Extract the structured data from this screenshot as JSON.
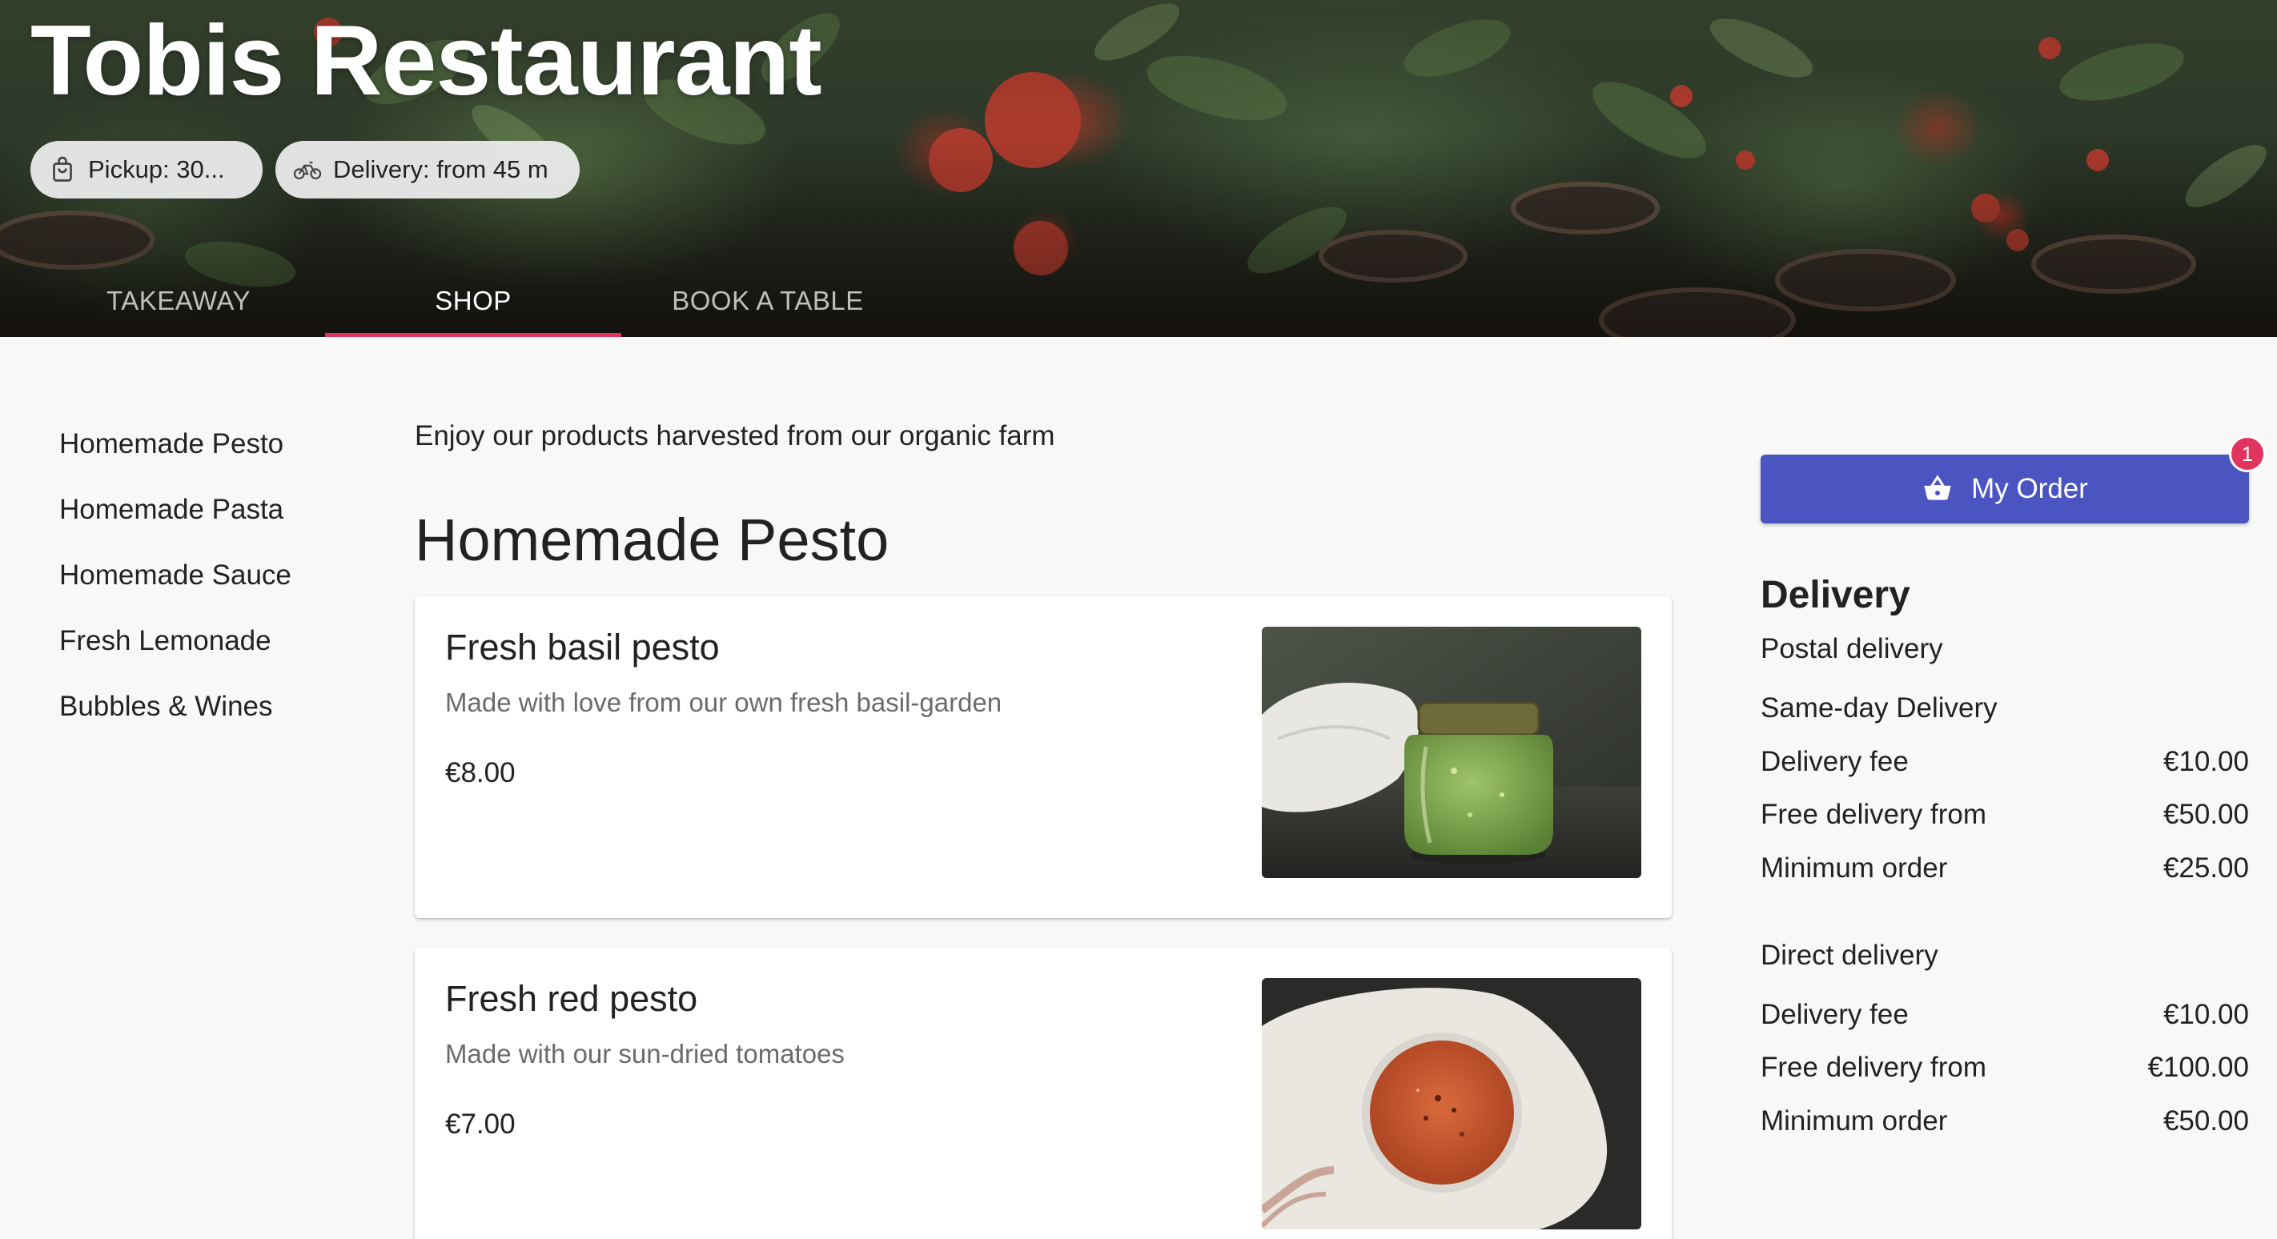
{
  "header": {
    "title": "Tobis Restaurant",
    "pickup_chip": {
      "icon": "shopping-bag-icon",
      "label": "Pickup: 30..."
    },
    "delivery_chip": {
      "icon": "bicycle-icon",
      "label": "Delivery: from 45 m"
    },
    "tabs": [
      {
        "label": "TAKEAWAY",
        "active": false
      },
      {
        "label": "SHOP",
        "active": true
      },
      {
        "label": "BOOK A TABLE",
        "active": false
      }
    ],
    "accent_color": "#e0335d"
  },
  "categories": [
    {
      "label": "Homemade Pesto"
    },
    {
      "label": "Homemade Pasta"
    },
    {
      "label": "Homemade Sauce"
    },
    {
      "label": "Fresh Lemonade"
    },
    {
      "label": "Bubbles & Wines"
    }
  ],
  "main": {
    "intro": "Enjoy our products harvested from our organic farm",
    "section_title": "Homemade Pesto",
    "products": [
      {
        "name": "Fresh basil pesto",
        "description": "Made with love from our own fresh basil-garden",
        "price": "€8.00",
        "image": "green-pesto-jar"
      },
      {
        "name": "Fresh red pesto",
        "description": "Made with our sun-dried tomatoes",
        "price": "€7.00",
        "image": "red-pesto-jar"
      }
    ]
  },
  "sidebar": {
    "order_button": {
      "icon": "basket-icon",
      "label": "My Order",
      "badge": "1",
      "color": "#4a55c2"
    },
    "delivery_heading": "Delivery",
    "postal_title": "Postal delivery",
    "postal_subtitle": "Same-day Delivery",
    "postal_rows": [
      {
        "label": "Delivery fee",
        "amount": "€10.00"
      },
      {
        "label": "Free delivery from",
        "amount": "€50.00"
      },
      {
        "label": "Minimum order",
        "amount": "€25.00"
      }
    ],
    "direct_title": "Direct delivery",
    "direct_rows": [
      {
        "label": "Delivery fee",
        "amount": "€10.00"
      },
      {
        "label": "Free delivery from",
        "amount": "€100.00"
      },
      {
        "label": "Minimum order",
        "amount": "€50.00"
      }
    ]
  }
}
